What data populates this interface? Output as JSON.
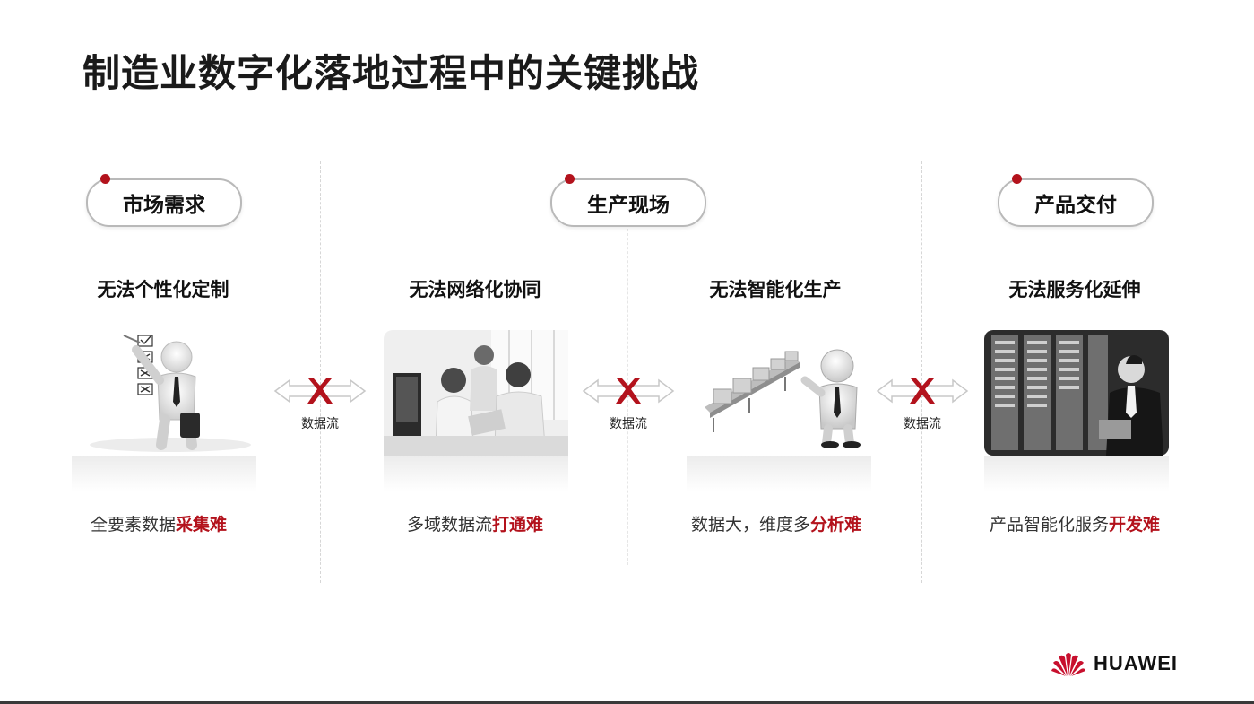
{
  "title": "制造业数字化落地过程中的关键挑战",
  "sections": [
    {
      "label": "市场需求"
    },
    {
      "label": "生产现场"
    },
    {
      "label": "产品交付"
    }
  ],
  "challenges": [
    {
      "title": "无法个性化定制",
      "bottom_prefix": "全要素数据",
      "bottom_highlight": "采集难",
      "image": "businessman-checklist-image"
    },
    {
      "title": "无法网络化协同",
      "bottom_prefix": "多域数据流",
      "bottom_highlight": "打通难",
      "image": "team-meeting-image"
    },
    {
      "title": "无法智能化生产",
      "bottom_prefix": "数据大，维度多",
      "bottom_highlight": "分析难",
      "image": "conveyor-figure-image"
    },
    {
      "title": "无法服务化延伸",
      "bottom_prefix": "产品智能化服务",
      "bottom_highlight": "开发难",
      "image": "server-room-image"
    }
  ],
  "flows": [
    {
      "label": "数据流"
    },
    {
      "label": "数据流"
    },
    {
      "label": "数据流"
    }
  ],
  "logo": {
    "text": "HUAWEI",
    "icon": "huawei-petal-logo"
  },
  "colors": {
    "accent": "#b3121c",
    "text": "#111111",
    "muted": "#333333"
  }
}
